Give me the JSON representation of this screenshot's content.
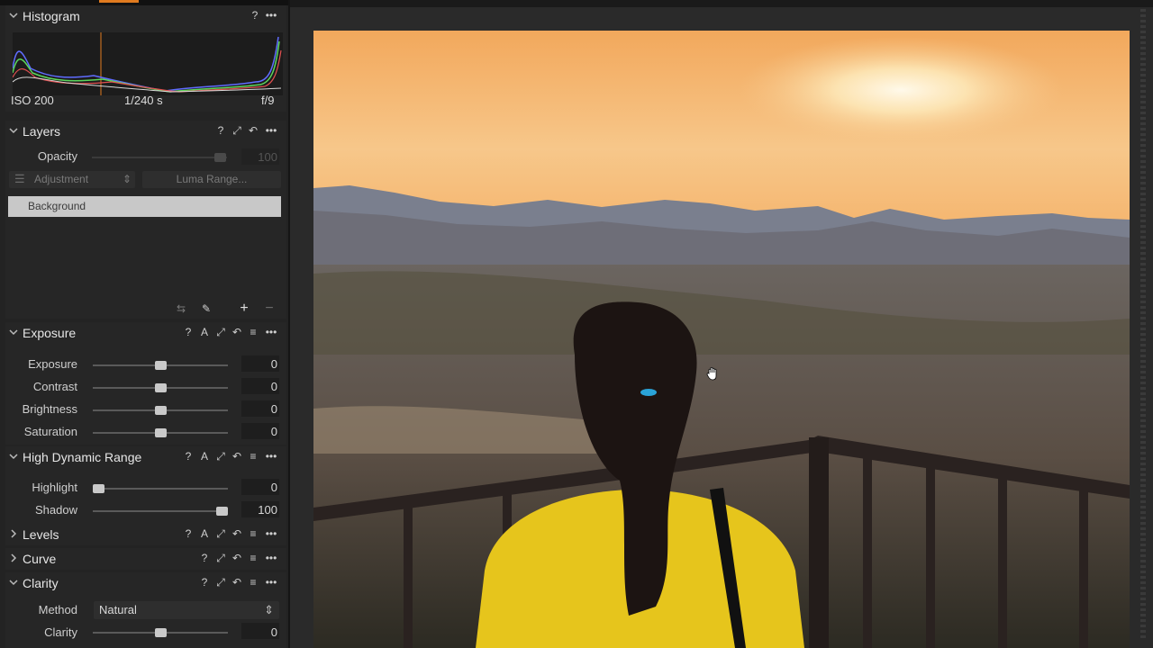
{
  "colors": {
    "accent": "#e07a1f",
    "panel": "#262626",
    "selected_layer": "#c8c8c8"
  },
  "histogram": {
    "title": "Histogram",
    "iso": "ISO 200",
    "shutter": "1/240 s",
    "aperture": "f/9",
    "header_icons": [
      "help-icon",
      "more-icon"
    ]
  },
  "layers": {
    "title": "Layers",
    "opacity_label": "Opacity",
    "opacity_value": "100",
    "adjustment_label": "Adjustment",
    "luma_label": "Luma Range...",
    "background_label": "Background",
    "header_icons": [
      "help-icon",
      "expand-icon",
      "reset-icon",
      "more-icon"
    ],
    "footer_icons": [
      "swap-icon",
      "brush-icon",
      "add-icon",
      "remove-icon"
    ]
  },
  "exposure": {
    "title": "Exposure",
    "sliders": [
      {
        "label": "Exposure",
        "value": "0",
        "level": 0.5
      },
      {
        "label": "Contrast",
        "value": "0",
        "level": 0.5
      },
      {
        "label": "Brightness",
        "value": "0",
        "level": 0.5
      },
      {
        "label": "Saturation",
        "value": "0",
        "level": 0.5
      }
    ]
  },
  "hdr": {
    "title": "High Dynamic Range",
    "sliders": [
      {
        "label": "Highlight",
        "value": "0",
        "level": 0.0
      },
      {
        "label": "Shadow",
        "value": "100",
        "level": 1.0
      }
    ]
  },
  "levels": {
    "title": "Levels"
  },
  "curve": {
    "title": "Curve"
  },
  "clarity": {
    "title": "Clarity",
    "method_label": "Method",
    "method_value": "Natural",
    "clarity_label": "Clarity",
    "clarity_value": "0",
    "clarity_level": 0.5
  }
}
